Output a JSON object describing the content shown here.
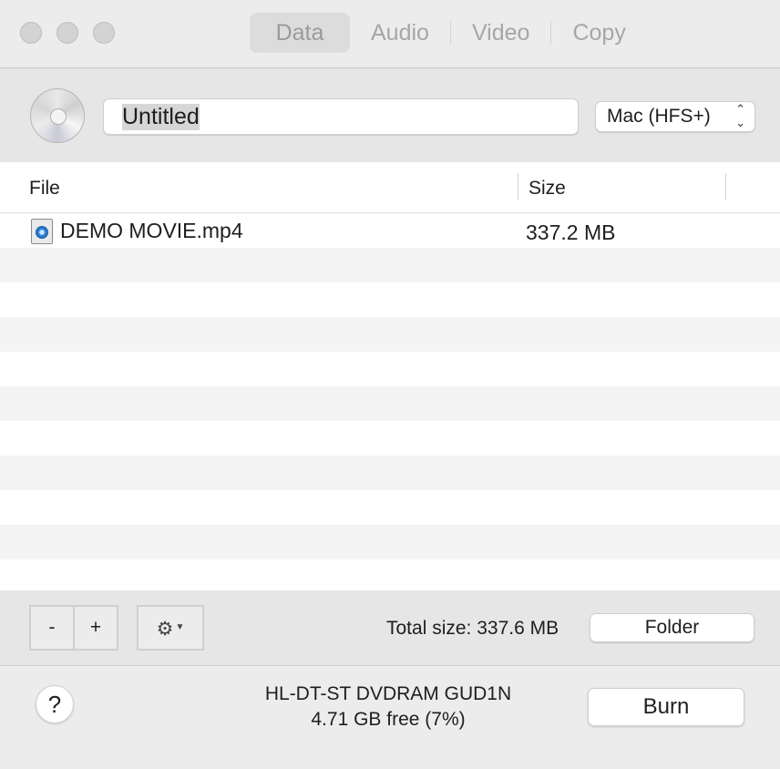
{
  "tabs": [
    {
      "label": "Data",
      "active": true
    },
    {
      "label": "Audio",
      "active": false
    },
    {
      "label": "Video",
      "active": false
    },
    {
      "label": "Copy",
      "active": false
    }
  ],
  "disc": {
    "name_value": "Untitled",
    "icon": "cd-disc-icon",
    "filesystem_selected": "Mac (HFS+)",
    "filesystem_chevron": "⌃⌄"
  },
  "list": {
    "headers": {
      "file": "File",
      "size": "Size"
    },
    "rows": [
      {
        "name": "DEMO MOVIE.mp4",
        "size": "337.2 MB",
        "icon": "quicktime-file-icon"
      }
    ]
  },
  "toolbar": {
    "remove_label": "-",
    "add_label": "+",
    "gear_icon": "⚙",
    "gear_dropdown": "▼",
    "total_size": "Total size: 337.6 MB",
    "folder_label": "Folder"
  },
  "bottom": {
    "help_label": "?",
    "drive_name": "HL-DT-ST DVDRAM GUD1N",
    "drive_free": "4.71 GB free (7%)",
    "burn_label": "Burn"
  }
}
